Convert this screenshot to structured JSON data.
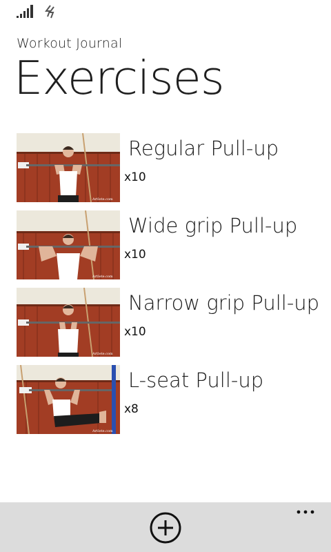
{
  "app": {
    "name": "Workout Journal",
    "page_title": "Exercises"
  },
  "status_bar": {
    "icons": [
      "signal-strength-icon",
      "data-connection-icon"
    ]
  },
  "exercises": [
    {
      "name": "Regular Pull-up",
      "reps": "x10",
      "image": "regular-pullup-photo",
      "watermark": "Artlete.com"
    },
    {
      "name": "Wide grip Pull-up",
      "reps": "x10",
      "image": "wide-grip-pullup-photo",
      "watermark": "Artlete.com"
    },
    {
      "name": "Narrow grip Pull-up",
      "reps": "x10",
      "image": "narrow-grip-pullup-photo",
      "watermark": "Artlete.com"
    },
    {
      "name": "L-seat Pull-up",
      "reps": "x8",
      "image": "l-seat-pullup-photo",
      "watermark": "Artlete.com"
    }
  ],
  "app_bar": {
    "add_icon": "add-circle-icon",
    "more_icon": "ellipsis-icon"
  },
  "colors": {
    "background": "#ffffff",
    "app_bar": "#dcdcdc",
    "text": "#1a1a1a",
    "wall_wood": "#9c3a22",
    "wall_cream": "#ece8dc"
  }
}
